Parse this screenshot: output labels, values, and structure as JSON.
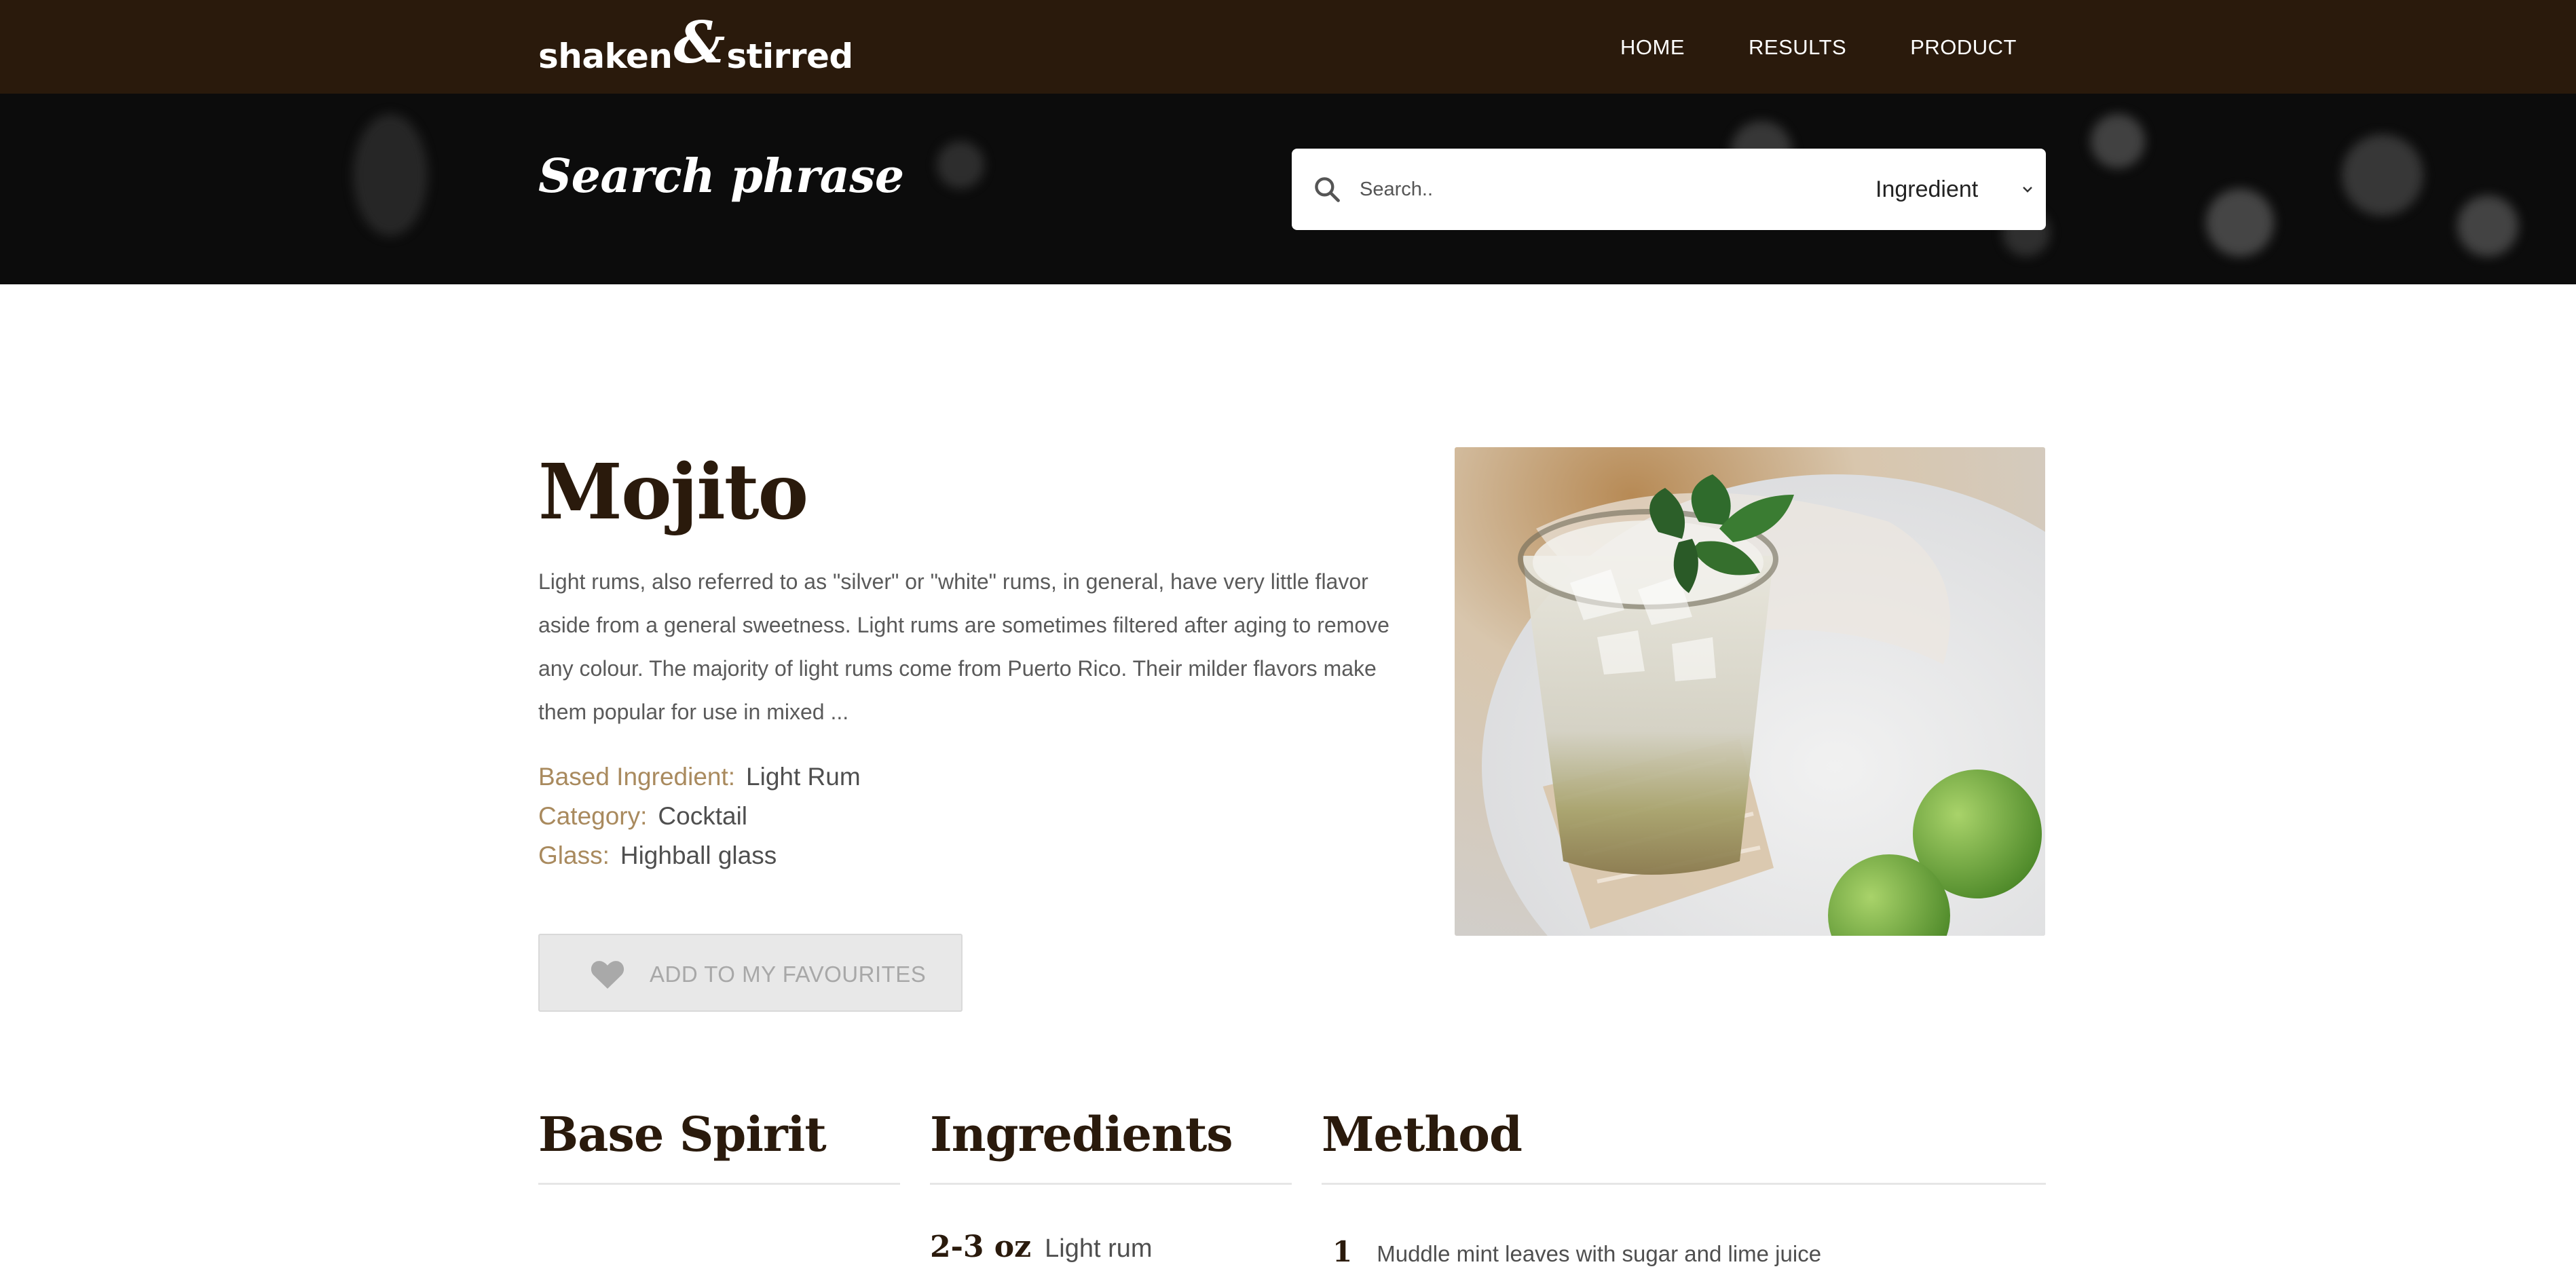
{
  "header": {
    "logo": {
      "word1": "shaken",
      "amp": "&",
      "word2": "stirred"
    },
    "nav": [
      {
        "label": "HOME"
      },
      {
        "label": "RESULTS"
      },
      {
        "label": "PRODUCT"
      }
    ]
  },
  "hero": {
    "title": "Search phrase",
    "search": {
      "placeholder": "Search..",
      "value": ""
    },
    "filter": {
      "selected": "Ingredient"
    }
  },
  "product": {
    "title": "Mojito",
    "description": "Light rums, also referred to as \"silver\" or \"white\" rums, in general, have very little flavor aside from a general sweetness. Light rums are sometimes filtered after aging to remove any colour. The majority of light rums come from Puerto Rico. Their milder flavors make them popular for use in mixed ...",
    "meta": [
      {
        "key": "Based Ingredient:",
        "value": "Light Rum"
      },
      {
        "key": "Category:",
        "value": "Cocktail"
      },
      {
        "key": "Glass:",
        "value": "Highball glass"
      }
    ],
    "favourite_label": "ADD TO MY FAVOURITES"
  },
  "sections": {
    "base_spirit": {
      "title": "Base Spirit"
    },
    "ingredients": {
      "title": "Ingredients",
      "items": [
        {
          "amount": "2-3 oz",
          "name": "Light rum"
        }
      ]
    },
    "method": {
      "title": "Method",
      "steps": [
        {
          "num": "1",
          "text": "Muddle mint leaves with sugar and lime juice"
        }
      ]
    }
  },
  "colors": {
    "brand_dark": "#2a1a0c",
    "meta_key": "#a98a5e",
    "button_bg": "#e8e8e8"
  },
  "icons": [
    "search-icon",
    "chevron-down-icon",
    "heart-icon"
  ]
}
